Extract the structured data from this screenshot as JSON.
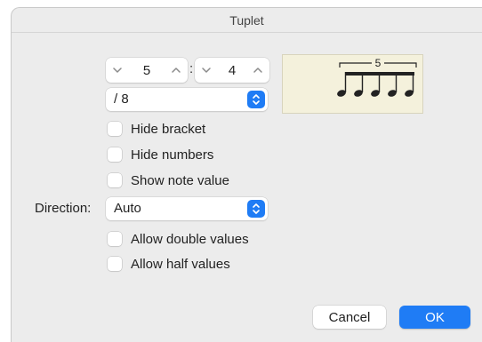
{
  "window": {
    "title": "Tuplet"
  },
  "tuplet": {
    "numerator": "5",
    "denominator": "4",
    "ratio_separator": ":",
    "note_value": "/ 8"
  },
  "preview": {
    "number": "5",
    "note_count": 5
  },
  "checkboxes": [
    {
      "label": "Hide bracket",
      "checked": false
    },
    {
      "label": "Hide numbers",
      "checked": false
    },
    {
      "label": "Show note value",
      "checked": false
    }
  ],
  "direction": {
    "label": "Direction:",
    "value": "Auto"
  },
  "options": [
    {
      "label": "Allow double values",
      "checked": false
    },
    {
      "label": "Allow half values",
      "checked": false
    }
  ],
  "buttons": {
    "cancel": "Cancel",
    "ok": "OK"
  },
  "colors": {
    "accent": "#1f7cf5",
    "preview_bg": "#f4f1dc"
  },
  "icons": {
    "decrement": "chevron-down-icon",
    "increment": "chevron-up-icon",
    "popup": "updown-chevron-icon"
  }
}
